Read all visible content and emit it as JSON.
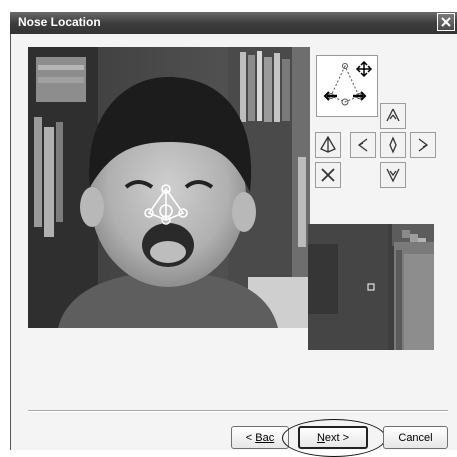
{
  "window": {
    "title": "Nose Location",
    "close_glyph": "✕"
  },
  "buttons": {
    "back_text": "Bac",
    "next_access": "N",
    "next_rest": "ext >",
    "cancel": "Cancel"
  },
  "tools": [
    {
      "name": "nose-up-icon",
      "glyph": "⋏"
    },
    {
      "name": "nose-shape-icon",
      "glyph": "⌂"
    },
    {
      "name": "nose-left-icon",
      "glyph": "<"
    },
    {
      "name": "nose-center-icon",
      "glyph": "◇"
    },
    {
      "name": "nose-right-icon",
      "glyph": ">"
    },
    {
      "name": "delete-icon",
      "glyph": "✕"
    },
    {
      "name": "nose-down-icon",
      "glyph": "⋎"
    }
  ],
  "colors": {
    "title_bar": "#3d3d3d",
    "dialog_bg": "#f4f4f4",
    "marker_stroke": "#ffffff"
  }
}
